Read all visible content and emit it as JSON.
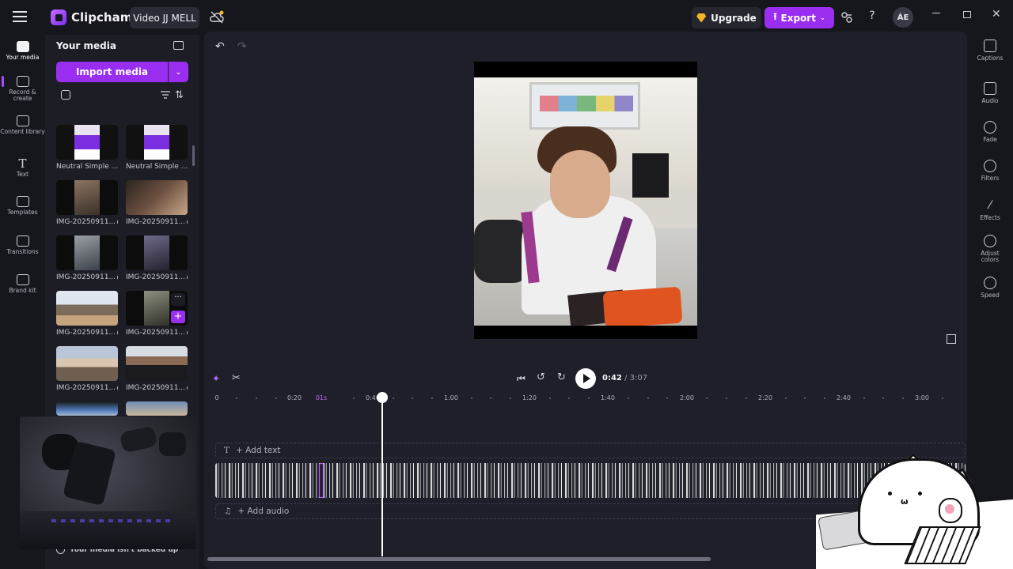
{
  "titlebar": {
    "app_name": "Clipchamp",
    "project_name": "Video JJ MELL",
    "upgrade_label": "Upgrade",
    "export_label": "Export",
    "help_label": "?",
    "avatar_initials": "ÁE",
    "accent_color": "#9a2ef0"
  },
  "rail": {
    "items": [
      {
        "label": "Your media",
        "icon": "folder-icon",
        "active": true
      },
      {
        "label": "Record & create",
        "icon": "camera-icon"
      },
      {
        "label": "Content library",
        "icon": "library-icon"
      },
      {
        "label": "Text",
        "icon": "text-icon"
      },
      {
        "label": "Templates",
        "icon": "templates-icon"
      },
      {
        "label": "Transitions",
        "icon": "transitions-icon"
      },
      {
        "label": "Brand kit",
        "icon": "brand-kit-icon"
      }
    ]
  },
  "media": {
    "title": "Your media",
    "import_label": "Import media",
    "items": [
      {
        "name": "Neutral Simple ..."
      },
      {
        "name": "Neutral Simple ..."
      },
      {
        "name": "IMG-20250911..."
      },
      {
        "name": "IMG-20250911..."
      },
      {
        "name": "IMG-20250911..."
      },
      {
        "name": "IMG-20250911..."
      },
      {
        "name": "IMG-20250911..."
      },
      {
        "name": "IMG-20250911..."
      },
      {
        "name": "IMG-20250911..."
      },
      {
        "name": "IMG-20250911..."
      }
    ],
    "backup_notice": "Your media isn't backed up"
  },
  "player": {
    "current_time": "0:42",
    "duration": "/ 3:07"
  },
  "ruler": {
    "labels": [
      "0",
      "0:20",
      "01s",
      "0:40",
      "1:00",
      "1:20",
      "1:40",
      "2:00",
      "2:20",
      "2:40",
      "3:00"
    ]
  },
  "tracks": {
    "add_text": "+ Add text",
    "add_audio": "+ Add audio"
  },
  "props": {
    "items": [
      {
        "label": "Captions",
        "icon": "captions-icon"
      },
      {
        "label": "Audio",
        "icon": "speaker-icon"
      },
      {
        "label": "Fade",
        "icon": "fade-icon"
      },
      {
        "label": "Filters",
        "icon": "filters-icon"
      },
      {
        "label": "Effects",
        "icon": "effects-icon"
      },
      {
        "label": "Adjust colors",
        "icon": "adjust-colors-icon"
      },
      {
        "label": "Speed",
        "icon": "speed-icon"
      }
    ]
  }
}
